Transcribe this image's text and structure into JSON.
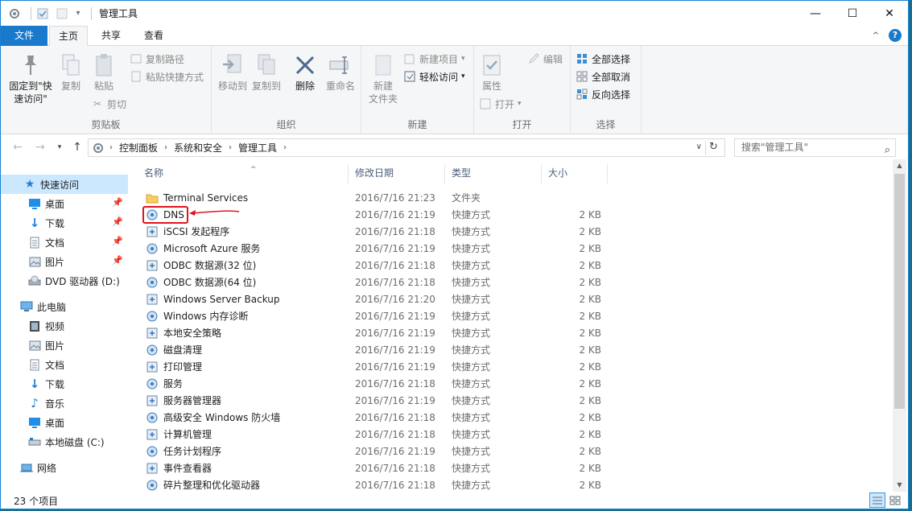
{
  "window": {
    "title": "管理工具",
    "controls": {
      "minimize": "—",
      "maximize": "☐",
      "close": "✕"
    }
  },
  "ribbon_tabs": {
    "file": "文件",
    "home": "主页",
    "share": "共享",
    "view": "查看"
  },
  "ribbon": {
    "clipboard": {
      "label": "剪贴板",
      "pin_line1": "固定到\"快",
      "pin_line2": "速访问\"",
      "copy": "复制",
      "paste": "粘贴",
      "copy_path": "复制路径",
      "paste_shortcut": "粘贴快捷方式",
      "cut": "剪切"
    },
    "organize": {
      "label": "组织",
      "move_to": "移动到",
      "copy_to": "复制到",
      "delete": "删除",
      "rename": "重命名"
    },
    "new": {
      "label": "新建",
      "new_folder_line1": "新建",
      "new_folder_line2": "文件夹",
      "new_item": "新建项目",
      "easy_access": "轻松访问"
    },
    "open": {
      "label": "打开",
      "properties": "属性",
      "open": "打开",
      "edit": "编辑"
    },
    "select": {
      "label": "选择",
      "select_all": "全部选择",
      "select_none": "全部取消",
      "invert": "反向选择"
    }
  },
  "address": {
    "breadcrumbs": [
      "控制面板",
      "系统和安全",
      "管理工具"
    ],
    "search_placeholder": "搜索\"管理工具\""
  },
  "nav": {
    "quick_access": "快速访问",
    "quick_items": [
      "桌面",
      "下载",
      "文档",
      "图片",
      "DVD 驱动器 (D:)"
    ],
    "this_pc": "此电脑",
    "pc_items": [
      "视频",
      "图片",
      "文档",
      "下载",
      "音乐",
      "桌面",
      "本地磁盘 (C:)"
    ],
    "network": "网络"
  },
  "columns": {
    "name": "名称",
    "date": "修改日期",
    "type": "类型",
    "size": "大小"
  },
  "files": [
    {
      "name": "Terminal Services",
      "date": "2016/7/16 21:23",
      "type": "文件夹",
      "size": ""
    },
    {
      "name": "DNS",
      "date": "2016/7/16 21:19",
      "type": "快捷方式",
      "size": "2 KB"
    },
    {
      "name": "iSCSI 发起程序",
      "date": "2016/7/16 21:18",
      "type": "快捷方式",
      "size": "2 KB"
    },
    {
      "name": "Microsoft Azure 服务",
      "date": "2016/7/16 21:19",
      "type": "快捷方式",
      "size": "2 KB"
    },
    {
      "name": "ODBC 数据源(32 位)",
      "date": "2016/7/16 21:18",
      "type": "快捷方式",
      "size": "2 KB"
    },
    {
      "name": "ODBC 数据源(64 位)",
      "date": "2016/7/16 21:18",
      "type": "快捷方式",
      "size": "2 KB"
    },
    {
      "name": "Windows Server Backup",
      "date": "2016/7/16 21:20",
      "type": "快捷方式",
      "size": "2 KB"
    },
    {
      "name": "Windows 内存诊断",
      "date": "2016/7/16 21:19",
      "type": "快捷方式",
      "size": "2 KB"
    },
    {
      "name": "本地安全策略",
      "date": "2016/7/16 21:19",
      "type": "快捷方式",
      "size": "2 KB"
    },
    {
      "name": "磁盘清理",
      "date": "2016/7/16 21:19",
      "type": "快捷方式",
      "size": "2 KB"
    },
    {
      "name": "打印管理",
      "date": "2016/7/16 21:19",
      "type": "快捷方式",
      "size": "2 KB"
    },
    {
      "name": "服务",
      "date": "2016/7/16 21:18",
      "type": "快捷方式",
      "size": "2 KB"
    },
    {
      "name": "服务器管理器",
      "date": "2016/7/16 21:19",
      "type": "快捷方式",
      "size": "2 KB"
    },
    {
      "name": "高级安全 Windows 防火墙",
      "date": "2016/7/16 21:18",
      "type": "快捷方式",
      "size": "2 KB"
    },
    {
      "name": "计算机管理",
      "date": "2016/7/16 21:18",
      "type": "快捷方式",
      "size": "2 KB"
    },
    {
      "name": "任务计划程序",
      "date": "2016/7/16 21:19",
      "type": "快捷方式",
      "size": "2 KB"
    },
    {
      "name": "事件查看器",
      "date": "2016/7/16 21:18",
      "type": "快捷方式",
      "size": "2 KB"
    },
    {
      "name": "碎片整理和优化驱动器",
      "date": "2016/7/16 21:18",
      "type": "快捷方式",
      "size": "2 KB"
    }
  ],
  "status": {
    "count": "23 个项目"
  },
  "colors": {
    "accent": "#1979ca",
    "selection": "#cce8ff",
    "annotation": "#e0141e"
  }
}
